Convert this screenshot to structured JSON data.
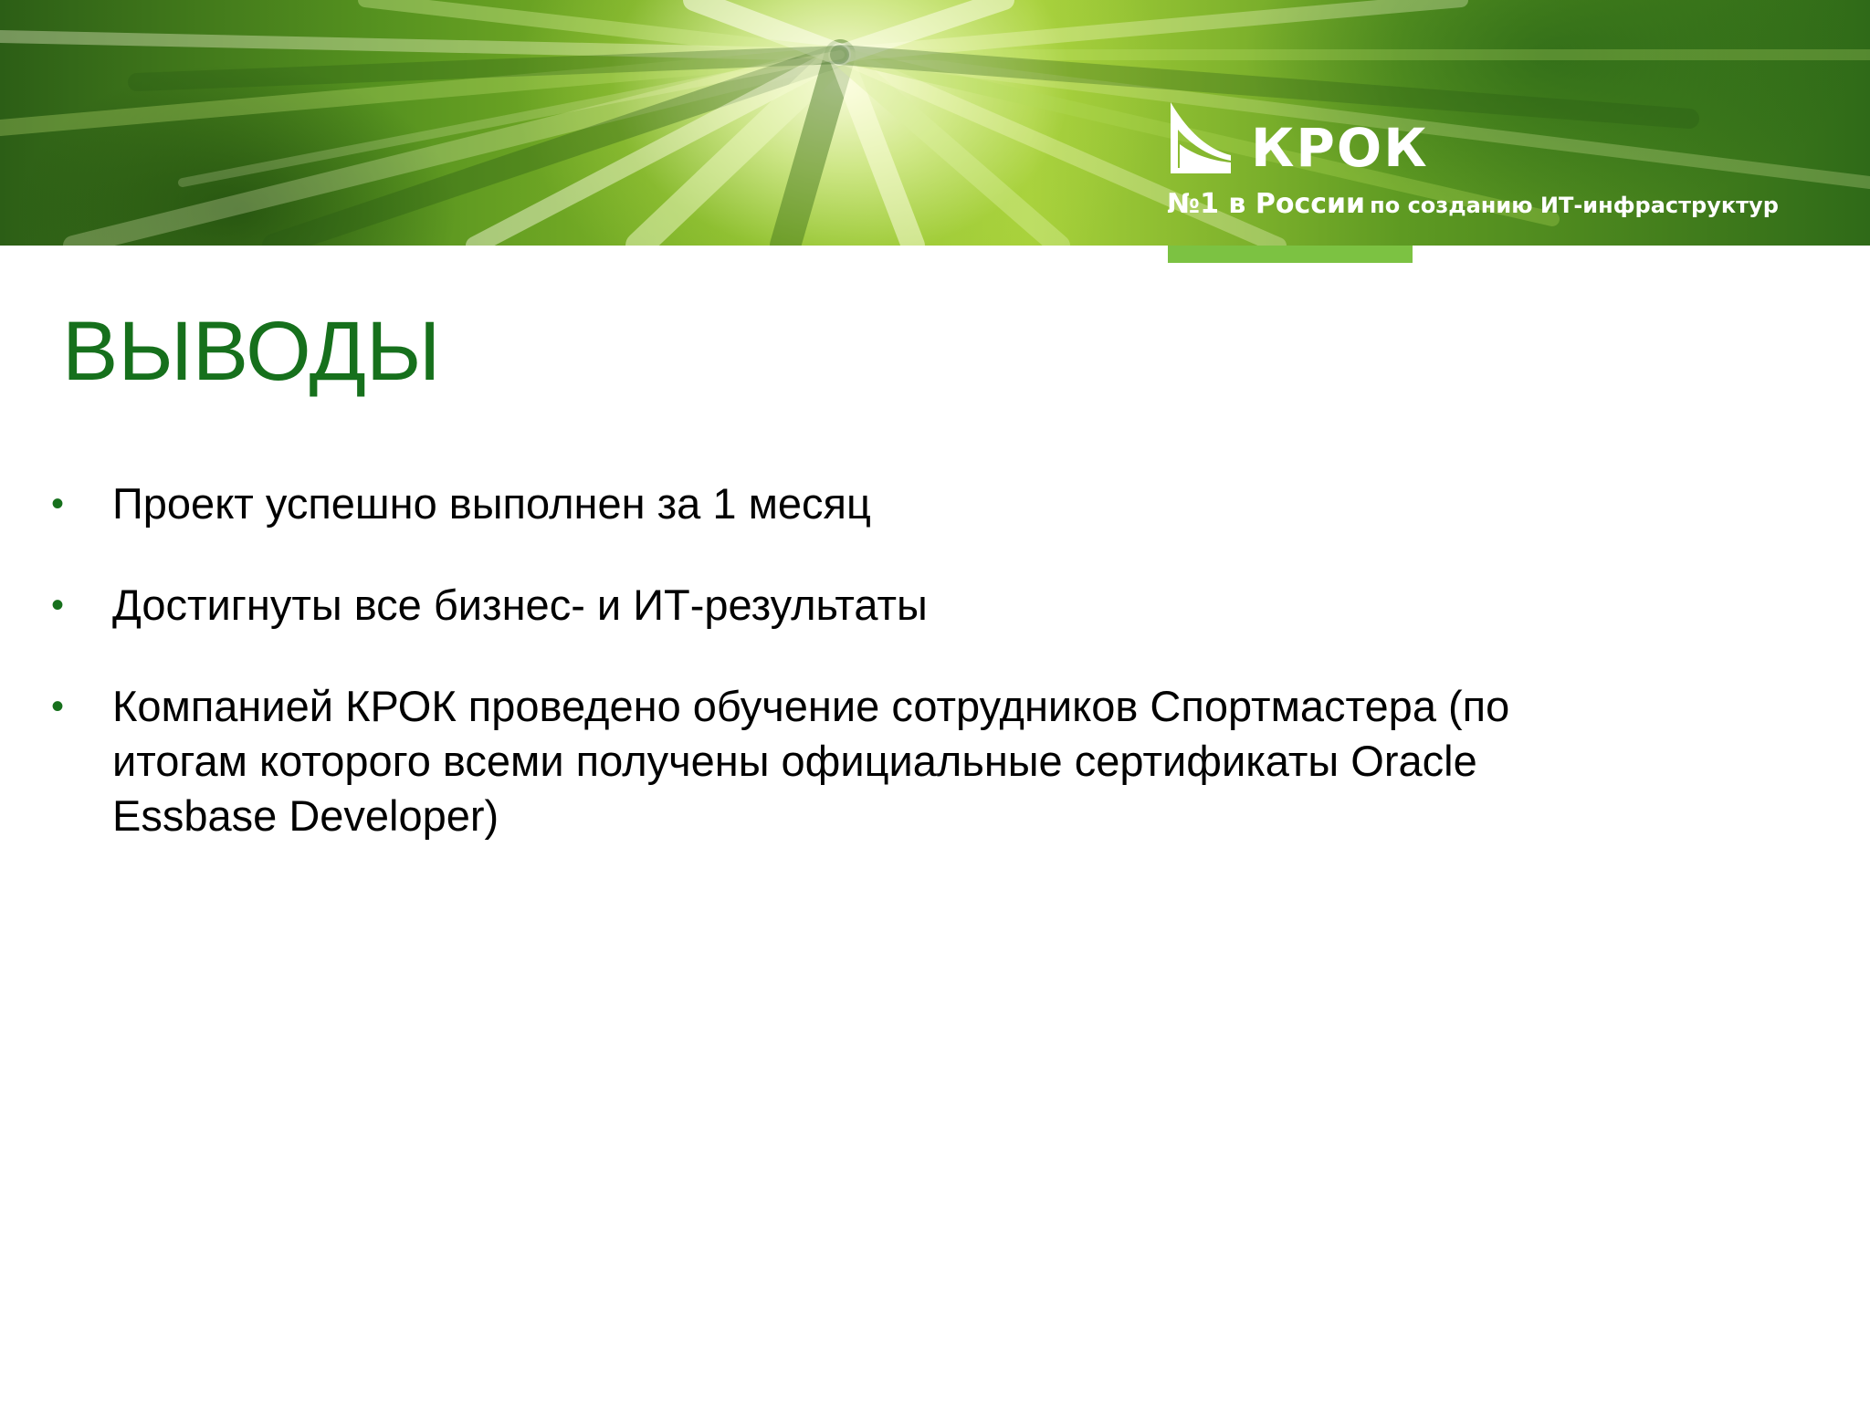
{
  "header": {
    "logo_name": "КРОК",
    "tagline_big": "№1 в России",
    "tagline_small": "по созданию ИТ-инфраструктур"
  },
  "slide": {
    "title": "ВЫВОДЫ",
    "bullets": [
      {
        "text": "Проект успешно выполнен за 1 месяц"
      },
      {
        "text": "Достигнуты все бизнес- и ИТ-результаты"
      },
      {
        "text": "Компанией КРОК проведено обучение сотрудников Спортмастера (по итогам которого всеми получены официальные сертификаты Oracle Essbase Developer)"
      }
    ]
  },
  "colors": {
    "title": "#16701c",
    "bullet": "#16701c",
    "accent_bar": "#7cc242",
    "body_text": "#000000"
  },
  "icons": {
    "logo_mark": "krok-wing-logo-icon",
    "bullet": "bullet-dot-icon"
  }
}
